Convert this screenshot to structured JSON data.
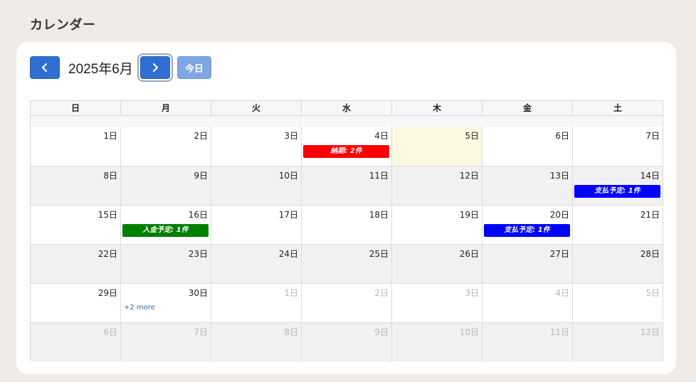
{
  "page": {
    "title": "カレンダー"
  },
  "toolbar": {
    "month_label": "2025年6月",
    "today_label": "今日"
  },
  "weekdays": [
    "日",
    "月",
    "火",
    "水",
    "木",
    "金",
    "土"
  ],
  "weeks": [
    [
      {
        "label": "1日"
      },
      {
        "label": "2日"
      },
      {
        "label": "3日"
      },
      {
        "label": "4日",
        "event": {
          "label": "納期: 2件",
          "color": "#ff0000"
        }
      },
      {
        "label": "5日",
        "today": true
      },
      {
        "label": "6日"
      },
      {
        "label": "7日"
      }
    ],
    [
      {
        "label": "8日"
      },
      {
        "label": "9日"
      },
      {
        "label": "10日"
      },
      {
        "label": "11日"
      },
      {
        "label": "12日"
      },
      {
        "label": "13日"
      },
      {
        "label": "14日",
        "event": {
          "label": "支払予定: 1件",
          "color": "#0000ff"
        }
      }
    ],
    [
      {
        "label": "15日"
      },
      {
        "label": "16日",
        "event": {
          "label": "入金予定: 1件",
          "color": "#008000"
        }
      },
      {
        "label": "17日"
      },
      {
        "label": "18日"
      },
      {
        "label": "19日"
      },
      {
        "label": "20日",
        "event": {
          "label": "支払予定: 1件",
          "color": "#0000ff"
        }
      },
      {
        "label": "21日"
      }
    ],
    [
      {
        "label": "22日"
      },
      {
        "label": "23日"
      },
      {
        "label": "24日"
      },
      {
        "label": "25日"
      },
      {
        "label": "26日"
      },
      {
        "label": "27日"
      },
      {
        "label": "28日"
      }
    ],
    [
      {
        "label": "29日"
      },
      {
        "label": "30日",
        "more": "+2 more"
      },
      {
        "label": "1日",
        "other": true
      },
      {
        "label": "2日",
        "other": true
      },
      {
        "label": "3日",
        "other": true
      },
      {
        "label": "4日",
        "other": true
      },
      {
        "label": "5日",
        "other": true
      }
    ],
    [
      {
        "label": "6日",
        "other": true
      },
      {
        "label": "7日",
        "other": true
      },
      {
        "label": "8日",
        "other": true
      },
      {
        "label": "9日",
        "other": true
      },
      {
        "label": "10日",
        "other": true
      },
      {
        "label": "11日",
        "other": true
      },
      {
        "label": "12日",
        "other": true
      }
    ]
  ]
}
